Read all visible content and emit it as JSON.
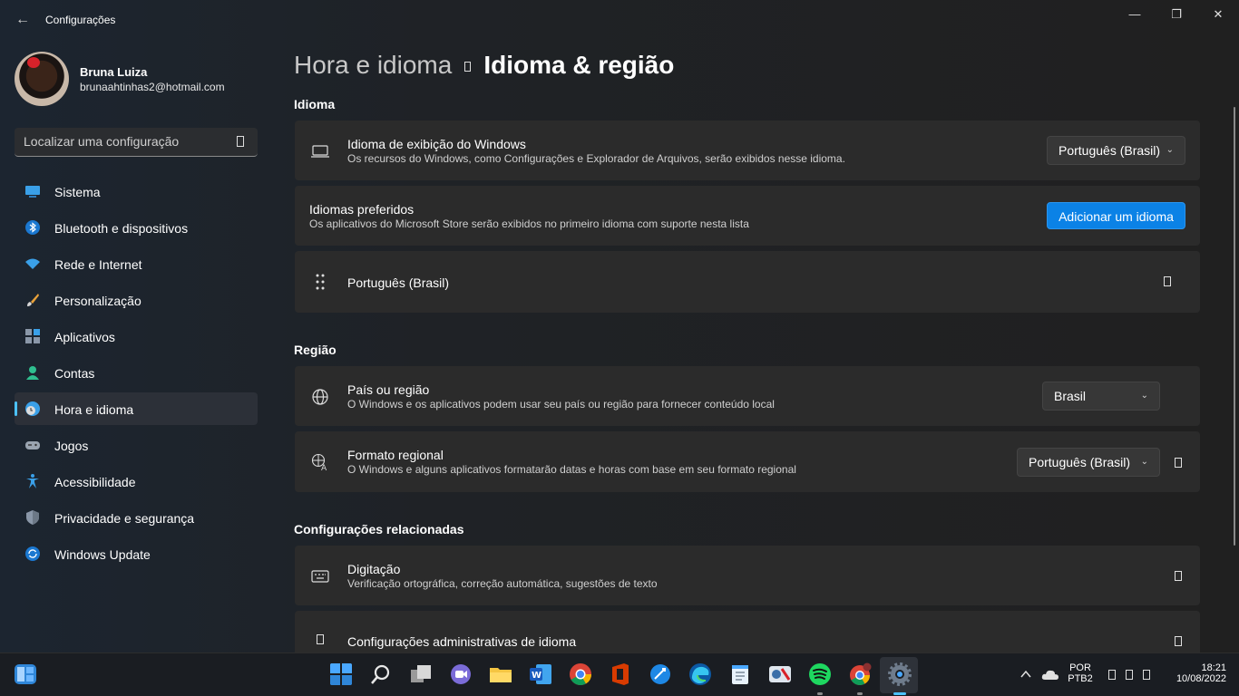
{
  "titlebar": {
    "app_title": "Configurações",
    "back_icon": "back-arrow-icon",
    "minimize_icon": "minimize-icon",
    "maximize_icon": "restore-icon",
    "close_icon": "close-icon"
  },
  "profile": {
    "name": "Bruna Luiza",
    "email": "brunaahtinhas2@hotmail.com"
  },
  "search": {
    "placeholder": "Localizar uma configuração"
  },
  "sidebar": {
    "items": [
      {
        "label": "Sistema",
        "icon": "system-icon",
        "active": false
      },
      {
        "label": "Bluetooth e dispositivos",
        "icon": "bluetooth-icon",
        "active": false
      },
      {
        "label": "Rede e Internet",
        "icon": "wifi-icon",
        "active": false
      },
      {
        "label": "Personalização",
        "icon": "brush-icon",
        "active": false
      },
      {
        "label": "Aplicativos",
        "icon": "apps-icon",
        "active": false
      },
      {
        "label": "Contas",
        "icon": "account-icon",
        "active": false
      },
      {
        "label": "Hora e idioma",
        "icon": "time-language-icon",
        "active": true
      },
      {
        "label": "Jogos",
        "icon": "gamepad-icon",
        "active": false
      },
      {
        "label": "Acessibilidade",
        "icon": "accessibility-icon",
        "active": false
      },
      {
        "label": "Privacidade e segurança",
        "icon": "shield-icon",
        "active": false
      },
      {
        "label": "Windows Update",
        "icon": "update-icon",
        "active": false
      }
    ]
  },
  "header": {
    "parent": "Hora e idioma",
    "current": "Idioma & região"
  },
  "language": {
    "section_title": "Idioma",
    "display": {
      "title": "Idioma de exibição do Windows",
      "subtitle": "Os recursos do Windows, como Configurações e Explorador de Arquivos, serão exibidos nesse idioma.",
      "value": "Português (Brasil)"
    },
    "preferred": {
      "title": "Idiomas preferidos",
      "subtitle": "Os aplicativos do Microsoft Store serão exibidos no primeiro idioma com suporte nesta lista",
      "button": "Adicionar um idioma"
    },
    "installed": {
      "label": "Português (Brasil)"
    }
  },
  "region": {
    "section_title": "Região",
    "country": {
      "title": "País ou região",
      "subtitle": "O Windows e os aplicativos podem usar seu país ou região para fornecer conteúdo local",
      "value": "Brasil"
    },
    "format": {
      "title": "Formato regional",
      "subtitle": "O Windows e alguns aplicativos formatarão datas e horas com base em seu formato regional",
      "value": "Português (Brasil)"
    }
  },
  "related": {
    "section_title": "Configurações relacionadas",
    "typing": {
      "title": "Digitação",
      "subtitle": "Verificação ortográfica, correção automática, sugestões de texto"
    },
    "admin": {
      "title": "Configurações administrativas de idioma"
    }
  },
  "taskbar": {
    "apps": [
      "widgets",
      "start",
      "search",
      "task-view",
      "teams-chat",
      "file-explorer",
      "word",
      "chrome",
      "office",
      "app-blue",
      "edge",
      "notepad",
      "app-misc",
      "spotify",
      "chrome-profile",
      "settings"
    ],
    "language_line1": "POR",
    "language_line2": "PTB2",
    "time": "18:21",
    "date": "10/08/2022"
  },
  "colors": {
    "accent": "#4cc2ff",
    "primary_button": "#0b82e6",
    "card_bg": "#2b2b2b"
  }
}
